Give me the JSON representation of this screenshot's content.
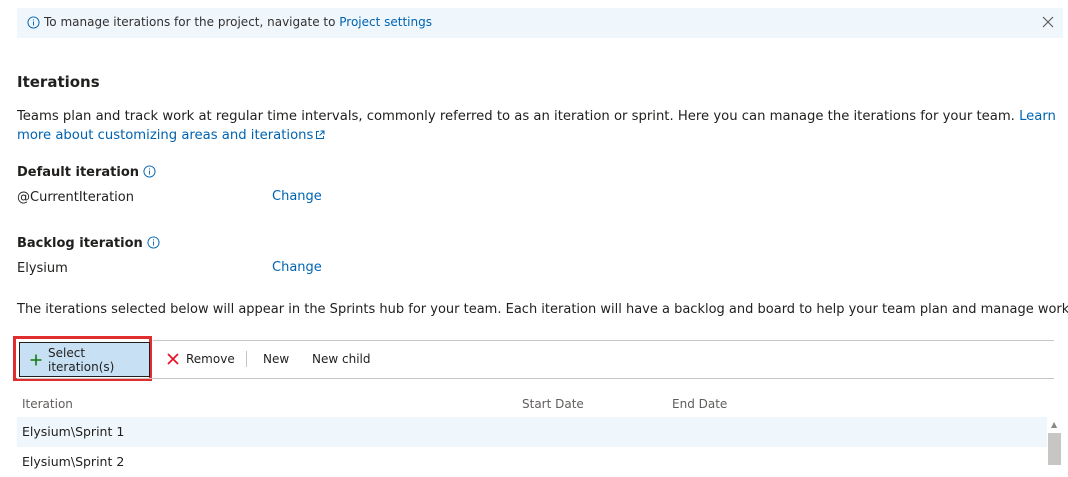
{
  "info_bar": {
    "message": "To manage iterations for the project, navigate to ",
    "link_label": "Project settings"
  },
  "section": {
    "title": "Iterations",
    "description": "Teams plan and track work at regular time intervals, commonly referred to as an iteration or sprint. Here you can manage the iterations for your team. ",
    "learn_more_label": "Learn more about customizing areas and iterations"
  },
  "default_iteration": {
    "label": "Default iteration",
    "value": "@CurrentIteration",
    "change_label": "Change"
  },
  "backlog_iteration": {
    "label": "Backlog iteration",
    "value": "Elysium",
    "change_label": "Change"
  },
  "note": "The iterations selected below will appear in the Sprints hub for your team. Each iteration will have a backlog and board to help your team plan and manage work.",
  "toolbar": {
    "select_label": "Select iteration(s)",
    "remove_label": "Remove",
    "new_label": "New",
    "new_child_label": "New child"
  },
  "table": {
    "columns": [
      "Iteration",
      "Start Date",
      "End Date"
    ],
    "rows": [
      {
        "iteration": "Elysium\\Sprint 1",
        "start": "",
        "end": ""
      },
      {
        "iteration": "Elysium\\Sprint 2",
        "start": "",
        "end": ""
      }
    ]
  },
  "colors": {
    "accent": "#0063b1",
    "info_bg": "#eff6fc",
    "highlight": "#e02e2e",
    "select_button_bg": "#c7e0f4",
    "add_icon": "#107c10",
    "remove_icon": "#e81123"
  }
}
